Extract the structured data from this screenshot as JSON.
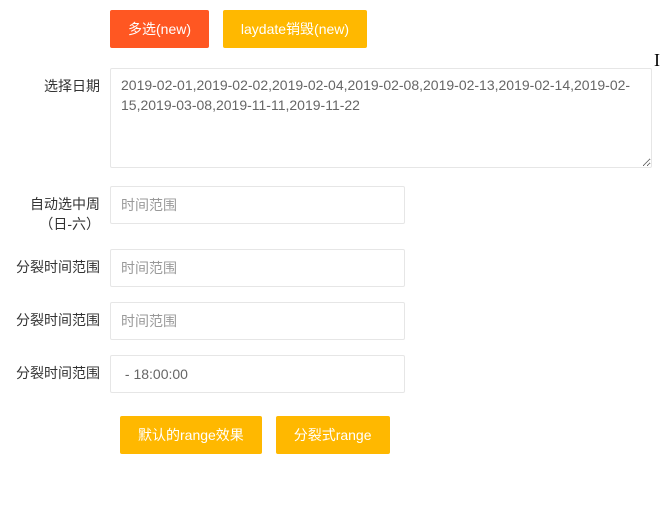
{
  "buttons": {
    "multi_select": "多选(new)",
    "laydate_destroy": "laydate销毁(new)",
    "default_range": "默认的range效果",
    "split_range": "分裂式range"
  },
  "labels": {
    "select_date": "选择日期",
    "auto_week": "自动选中周（日-六）",
    "split_time_1": "分裂时间范围",
    "split_time_2": "分裂时间范围",
    "split_time_3": "分裂时间范围"
  },
  "values": {
    "select_date": "2019-02-01,2019-02-02,2019-02-04,2019-02-08,2019-02-13,2019-02-14,2019-02-15,2019-03-08,2019-11-11,2019-11-22",
    "split_time_3": " - 18:00:00"
  },
  "placeholders": {
    "time_range": "时间范围"
  }
}
